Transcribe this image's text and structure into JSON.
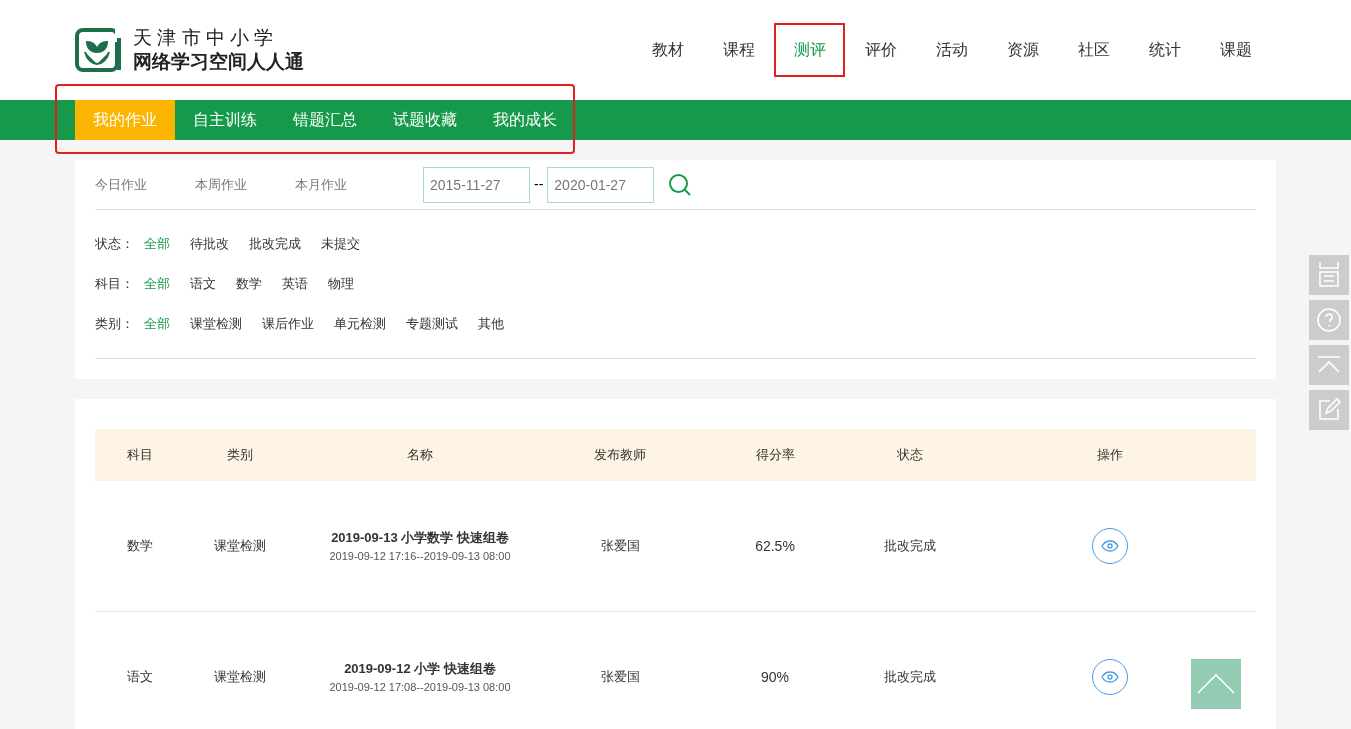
{
  "logo": {
    "line1": "天 津 市 中 小 学",
    "line2": "网络学习空间人人通"
  },
  "nav": [
    {
      "label": "教材",
      "selected": false
    },
    {
      "label": "课程",
      "selected": false
    },
    {
      "label": "测评",
      "selected": true
    },
    {
      "label": "评价",
      "selected": false
    },
    {
      "label": "活动",
      "selected": false
    },
    {
      "label": "资源",
      "selected": false
    },
    {
      "label": "社区",
      "selected": false
    },
    {
      "label": "统计",
      "selected": false
    },
    {
      "label": "课题",
      "selected": false
    }
  ],
  "subnav": [
    {
      "label": "我的作业",
      "selected": true
    },
    {
      "label": "自主训练",
      "selected": false
    },
    {
      "label": "错题汇总",
      "selected": false
    },
    {
      "label": "试题收藏",
      "selected": false
    },
    {
      "label": "我的成长",
      "selected": false
    }
  ],
  "period_tabs": [
    "今日作业",
    "本周作业",
    "本月作业"
  ],
  "date_from": "2015-11-27",
  "date_separator": "--",
  "date_to": "2020-01-27",
  "filters": [
    {
      "label": "状态：",
      "options": [
        {
          "label": "全部",
          "selected": true
        },
        {
          "label": "待批改",
          "selected": false
        },
        {
          "label": "批改完成",
          "selected": false
        },
        {
          "label": "未提交",
          "selected": false
        }
      ]
    },
    {
      "label": "科目：",
      "options": [
        {
          "label": "全部",
          "selected": true
        },
        {
          "label": "语文",
          "selected": false
        },
        {
          "label": "数学",
          "selected": false
        },
        {
          "label": "英语",
          "selected": false
        },
        {
          "label": "物理",
          "selected": false
        }
      ]
    },
    {
      "label": "类别：",
      "options": [
        {
          "label": "全部",
          "selected": true
        },
        {
          "label": "课堂检测",
          "selected": false
        },
        {
          "label": "课后作业",
          "selected": false
        },
        {
          "label": "单元检测",
          "selected": false
        },
        {
          "label": "专题测试",
          "selected": false
        },
        {
          "label": "其他",
          "selected": false
        }
      ]
    }
  ],
  "table": {
    "columns": [
      "科目",
      "类别",
      "名称",
      "发布教师",
      "得分率",
      "状态",
      "操作"
    ],
    "rows": [
      {
        "subject": "数学",
        "category": "课堂检测",
        "name": "2019-09-13 小学数学 快速组卷",
        "time": "2019-09-12 17:16--2019-09-13 08:00",
        "teacher": "张爱国",
        "score": "62.5%",
        "status": "批改完成"
      },
      {
        "subject": "语文",
        "category": "课堂检测",
        "name": "2019-09-12 小学 快速组卷",
        "time": "2019-09-12 17:08--2019-09-13 08:00",
        "teacher": "张爱国",
        "score": "90%",
        "status": "批改完成"
      }
    ]
  }
}
